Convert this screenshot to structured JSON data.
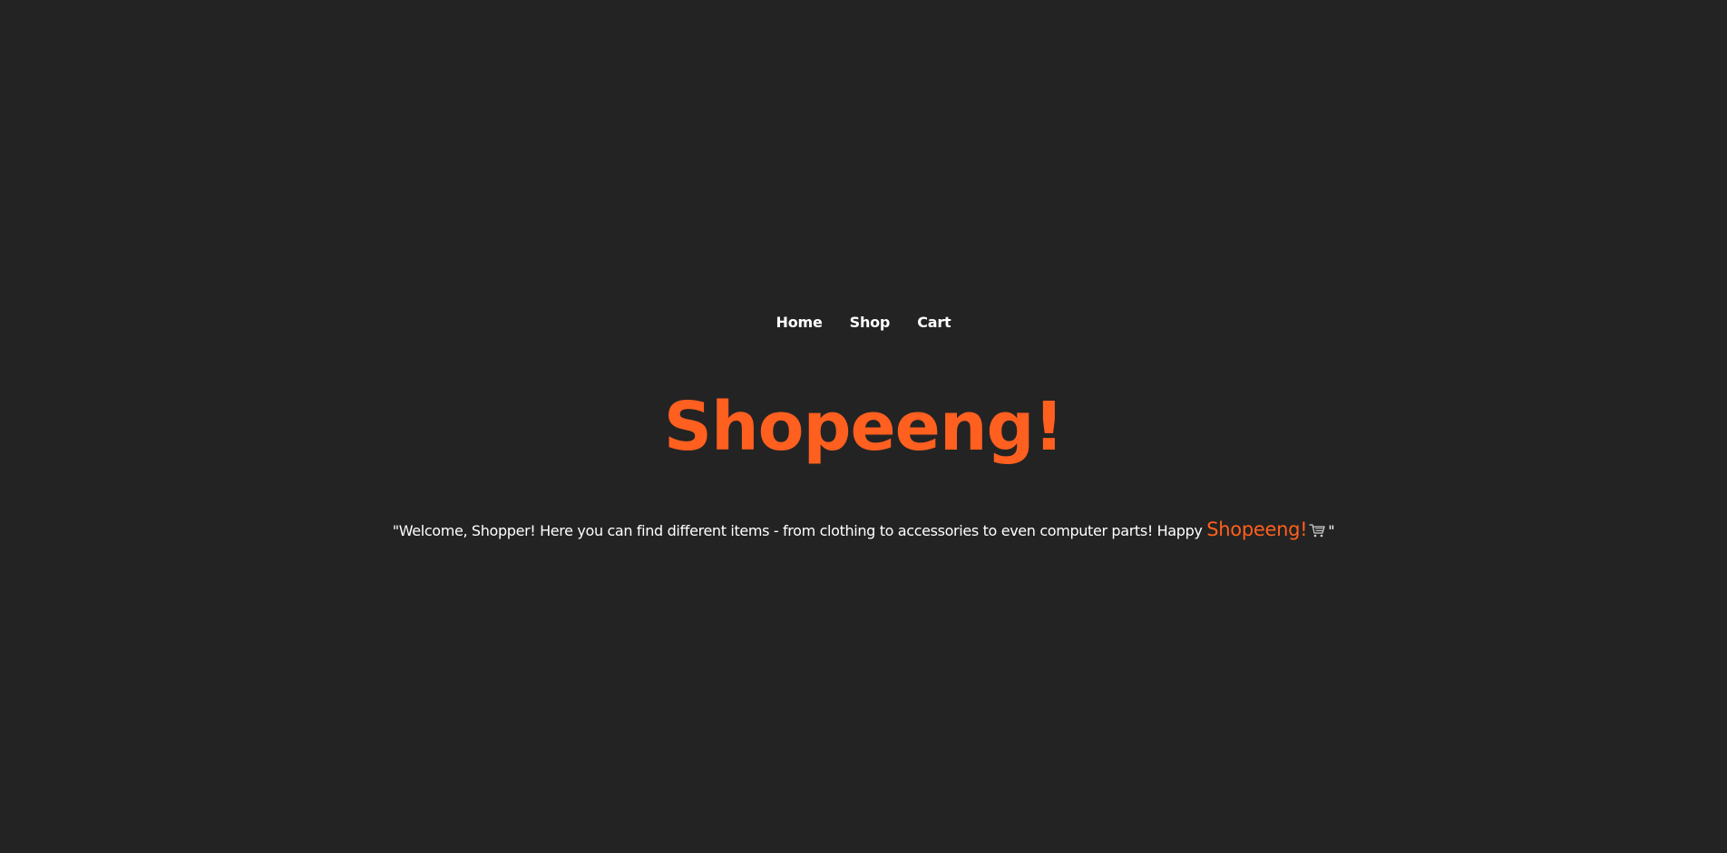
{
  "colors": {
    "background": "#232323",
    "accent": "#ff5f1f",
    "text": "#ffffff"
  },
  "nav": {
    "items": [
      {
        "label": "Home"
      },
      {
        "label": "Shop"
      },
      {
        "label": "Cart"
      }
    ]
  },
  "hero": {
    "title": "Shopeeng!",
    "tagline": {
      "open_quote": "\"",
      "text": "Welcome, Shopper! Here you can find different items - from clothing to accessories to even computer parts! Happy ",
      "brand": "Shopeeng!",
      "icon": "shopping-cart-icon",
      "close_quote": "\""
    }
  }
}
